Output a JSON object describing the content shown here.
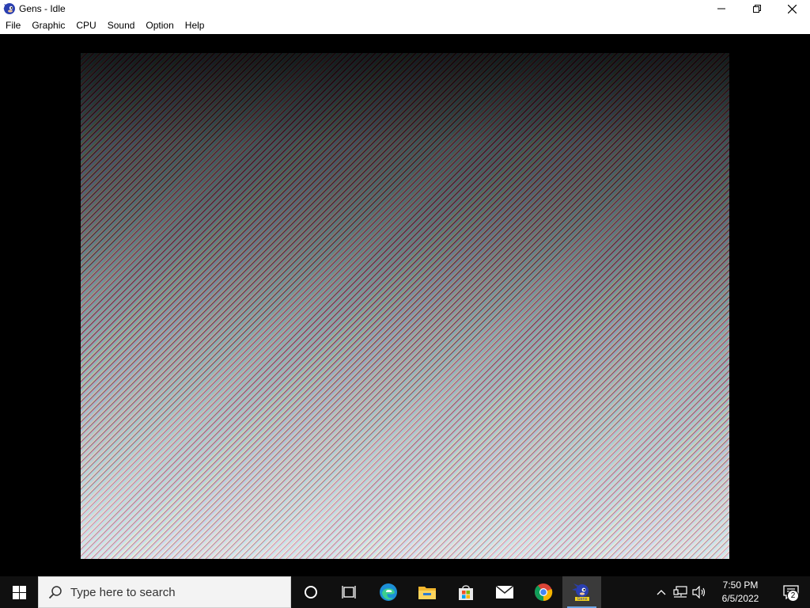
{
  "window": {
    "title": "Gens - Idle",
    "app_icon": "gens-sonic-icon",
    "controls": [
      "minimize-icon",
      "restore-icon",
      "close-icon"
    ]
  },
  "menu": {
    "items": [
      {
        "label": "File"
      },
      {
        "label": "Graphic"
      },
      {
        "label": "CPU"
      },
      {
        "label": "Sound"
      },
      {
        "label": "Option"
      },
      {
        "label": "Help"
      }
    ]
  },
  "game_screen": {
    "content": "static-noise"
  },
  "taskbar": {
    "search_placeholder": "Type here to search",
    "pinned": [
      {
        "name": "cortana-icon"
      },
      {
        "name": "task-view-icon"
      },
      {
        "name": "edge-icon"
      },
      {
        "name": "file-explorer-icon"
      },
      {
        "name": "microsoft-store-icon"
      },
      {
        "name": "mail-icon"
      },
      {
        "name": "chrome-icon"
      },
      {
        "name": "gens-icon"
      }
    ],
    "clock": {
      "time": "7:50 PM",
      "date": "6/5/2022"
    },
    "notification_count": "2"
  },
  "colors": {
    "taskbar_bg": "#101010",
    "titlebar_bg": "#ffffff",
    "accent": "#6aa5e6"
  }
}
